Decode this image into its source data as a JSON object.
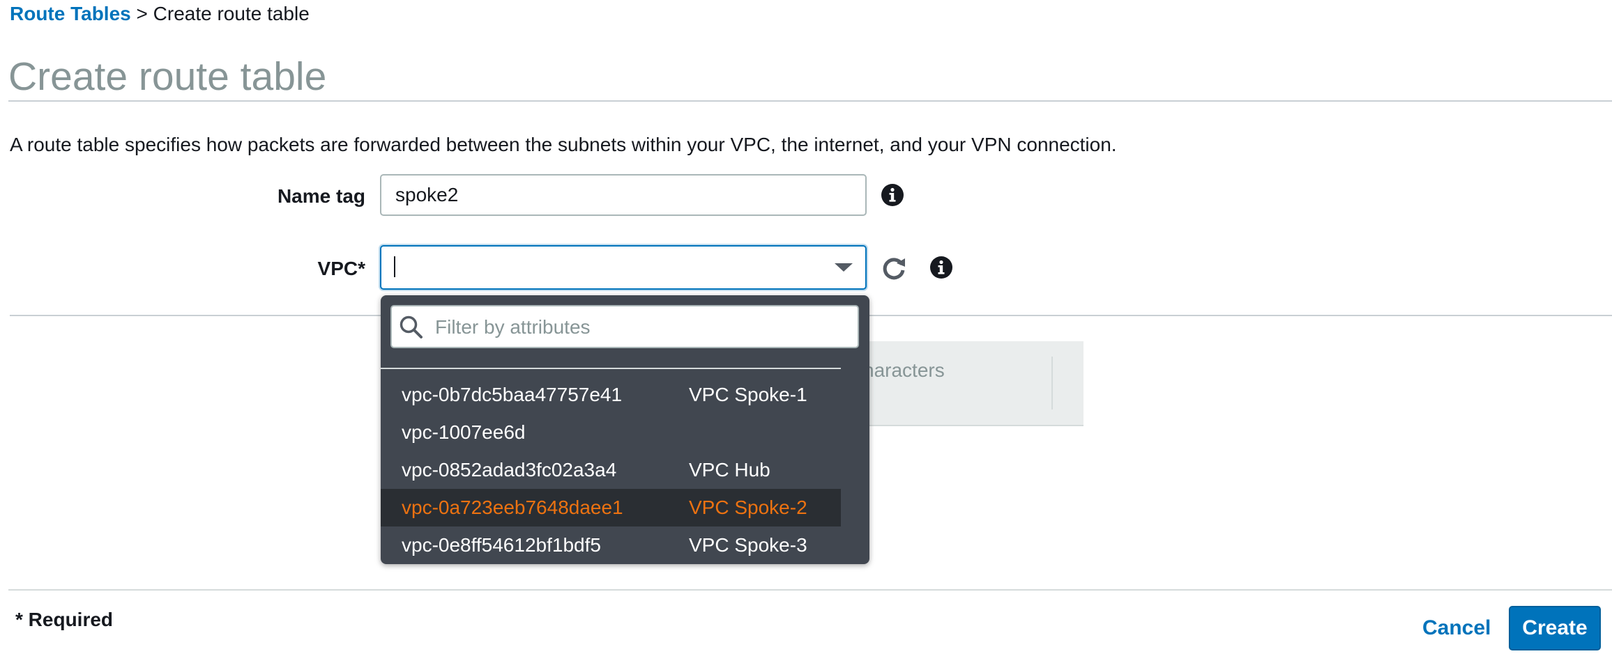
{
  "breadcrumb": {
    "parent": "Route Tables",
    "separator": ">",
    "current": "Create route table"
  },
  "page_title": "Create route table",
  "description": "A route table specifies how packets are forwarded between the subnets within your VPC, the internet, and your VPN connection.",
  "form": {
    "name_tag": {
      "label": "Name tag",
      "value": "spoke2"
    },
    "vpc": {
      "label": "VPC*",
      "value": ""
    }
  },
  "dropdown": {
    "filter_placeholder": "Filter by attributes",
    "options": [
      {
        "id": "vpc-0b7dc5baa47757e41",
        "name": "VPC Spoke-1"
      },
      {
        "id": "vpc-1007ee6d",
        "name": ""
      },
      {
        "id": "vpc-0852adad3fc02a3a4",
        "name": "VPC Hub"
      },
      {
        "id": "vpc-0a723eeb7648daee1",
        "name": "VPC Spoke-2",
        "highlighted": true
      },
      {
        "id": "vpc-0e8ff54612bf1bdf5",
        "name": "VPC Spoke-3"
      }
    ]
  },
  "background_fragment": "haracters",
  "footer": {
    "required_note": "* Required",
    "cancel_label": "Cancel",
    "create_label": "Create"
  },
  "colors": {
    "link": "#0073bb",
    "highlight_text": "#ec7211",
    "dropdown_bg": "#414750",
    "primary_button": "#0073bb"
  },
  "icons": {
    "info": "info-icon",
    "refresh": "refresh-icon",
    "search": "search-icon",
    "caret": "chevron-down-icon"
  }
}
